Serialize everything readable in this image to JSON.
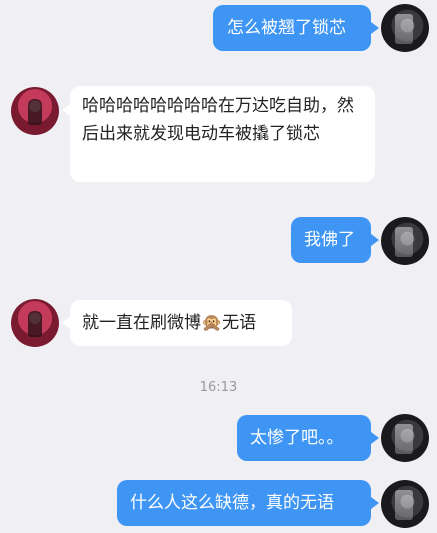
{
  "messages": [
    {
      "side": "right",
      "text": "怎么被翘了锁芯"
    },
    {
      "side": "left",
      "text": "哈哈哈哈哈哈哈哈在万达吃自助，然后出来就发现电动车被撬了锁芯"
    },
    {
      "side": "right",
      "text": "我佛了"
    },
    {
      "side": "left",
      "text_before": "就一直在刷微博",
      "emoji": "🙊",
      "text_after": "无语"
    },
    {
      "side": "right",
      "text": "太惨了吧。。"
    },
    {
      "side": "right",
      "text": "什么人这么缺德，真的无语"
    }
  ],
  "timestamp": "16:13",
  "colors": {
    "background": "#efeff4",
    "outgoing_bubble": "#3e95f4",
    "incoming_bubble": "#ffffff"
  }
}
